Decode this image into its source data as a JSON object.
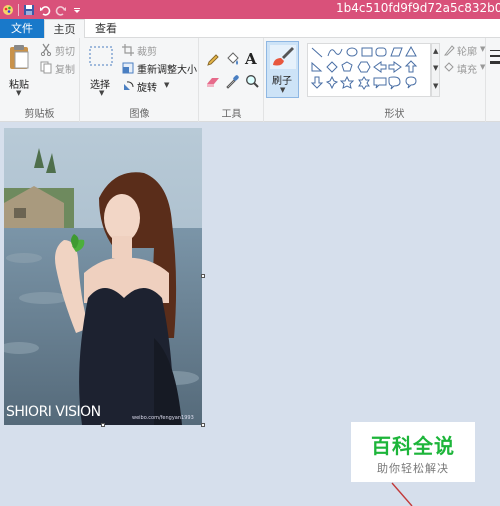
{
  "window": {
    "title": "1b4c510fd9f9d72a5c832b00"
  },
  "tabs": [
    {
      "label": "文件"
    },
    {
      "label": "主页"
    },
    {
      "label": "查看"
    }
  ],
  "ribbon": {
    "clipboard": {
      "group_label": "剪贴板",
      "paste": "粘贴",
      "cut": "剪切",
      "copy": "复制"
    },
    "image": {
      "group_label": "图像",
      "select": "选择",
      "crop": "裁剪",
      "resize": "重新调整大小",
      "rotate": "旋转"
    },
    "tools": {
      "group_label": "工具",
      "text_tool": "A"
    },
    "brushes": {
      "label": "刷子"
    },
    "shapes": {
      "group_label": "形状",
      "outline": "轮廓",
      "fill": "填充"
    }
  },
  "canvas": {
    "photo_caption": "SHIORI VISION",
    "photo_credit": "weibo.com/fengyan1993"
  },
  "watermark": {
    "title": "百科全说",
    "subtitle": "助你轻松解决"
  },
  "colors": {
    "titlebar": "#d9517a",
    "file_tab": "#1979ca",
    "ribbon_bg": "#f5f6f7",
    "workspace_bg": "#d6dfec",
    "watermark_green": "#1db53a"
  }
}
